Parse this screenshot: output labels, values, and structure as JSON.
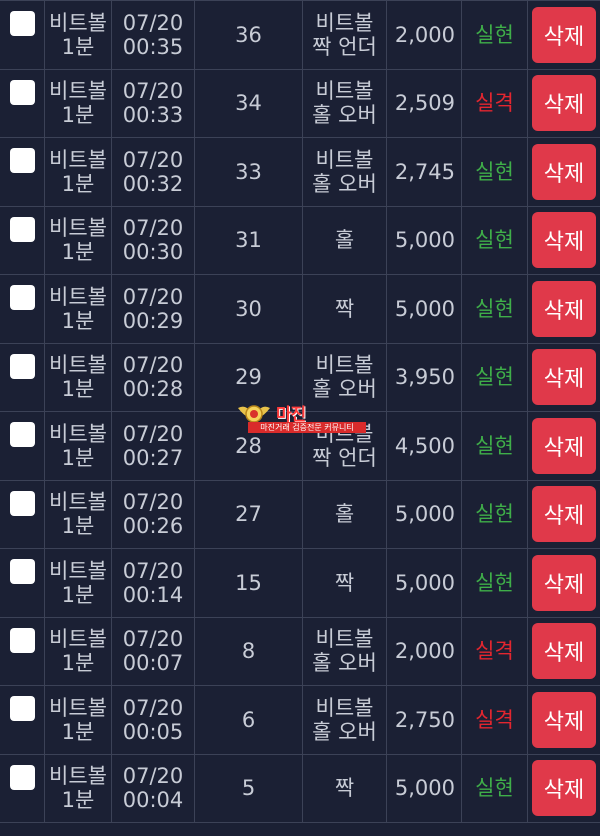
{
  "colors": {
    "background": "#1b2034",
    "win": "#3fae49",
    "lose": "#e3262f",
    "delete_button": "#e0394a"
  },
  "watermark": {
    "title": "마진",
    "subtitle": "마진거래 검증전문 커뮤니티"
  },
  "rows": [
    {
      "game": [
        "비트볼",
        "1분"
      ],
      "date": "07/20",
      "time": "00:35",
      "round": "36",
      "pick": [
        "비트볼",
        "짝 언더"
      ],
      "amount": "2,000",
      "result": "실현",
      "result_type": "win",
      "action": "삭제"
    },
    {
      "game": [
        "비트볼",
        "1분"
      ],
      "date": "07/20",
      "time": "00:33",
      "round": "34",
      "pick": [
        "비트볼",
        "홀 오버"
      ],
      "amount": "2,509",
      "result": "실격",
      "result_type": "lose",
      "action": "삭제"
    },
    {
      "game": [
        "비트볼",
        "1분"
      ],
      "date": "07/20",
      "time": "00:32",
      "round": "33",
      "pick": [
        "비트볼",
        "홀 오버"
      ],
      "amount": "2,745",
      "result": "실현",
      "result_type": "win",
      "action": "삭제"
    },
    {
      "game": [
        "비트볼",
        "1분"
      ],
      "date": "07/20",
      "time": "00:30",
      "round": "31",
      "pick": [
        "홀"
      ],
      "amount": "5,000",
      "result": "실현",
      "result_type": "win",
      "action": "삭제"
    },
    {
      "game": [
        "비트볼",
        "1분"
      ],
      "date": "07/20",
      "time": "00:29",
      "round": "30",
      "pick": [
        "짝"
      ],
      "amount": "5,000",
      "result": "실현",
      "result_type": "win",
      "action": "삭제"
    },
    {
      "game": [
        "비트볼",
        "1분"
      ],
      "date": "07/20",
      "time": "00:28",
      "round": "29",
      "pick": [
        "비트볼",
        "홀 오버"
      ],
      "amount": "3,950",
      "result": "실현",
      "result_type": "win",
      "action": "삭제"
    },
    {
      "game": [
        "비트볼",
        "1분"
      ],
      "date": "07/20",
      "time": "00:27",
      "round": "28",
      "pick": [
        "비트볼",
        "짝 언더"
      ],
      "amount": "4,500",
      "result": "실현",
      "result_type": "win",
      "action": "삭제"
    },
    {
      "game": [
        "비트볼",
        "1분"
      ],
      "date": "07/20",
      "time": "00:26",
      "round": "27",
      "pick": [
        "홀"
      ],
      "amount": "5,000",
      "result": "실현",
      "result_type": "win",
      "action": "삭제"
    },
    {
      "game": [
        "비트볼",
        "1분"
      ],
      "date": "07/20",
      "time": "00:14",
      "round": "15",
      "pick": [
        "짝"
      ],
      "amount": "5,000",
      "result": "실현",
      "result_type": "win",
      "action": "삭제"
    },
    {
      "game": [
        "비트볼",
        "1분"
      ],
      "date": "07/20",
      "time": "00:07",
      "round": "8",
      "pick": [
        "비트볼",
        "홀 오버"
      ],
      "amount": "2,000",
      "result": "실격",
      "result_type": "lose",
      "action": "삭제"
    },
    {
      "game": [
        "비트볼",
        "1분"
      ],
      "date": "07/20",
      "time": "00:05",
      "round": "6",
      "pick": [
        "비트볼",
        "홀 오버"
      ],
      "amount": "2,750",
      "result": "실격",
      "result_type": "lose",
      "action": "삭제"
    },
    {
      "game": [
        "비트볼",
        "1분"
      ],
      "date": "07/20",
      "time": "00:04",
      "round": "5",
      "pick": [
        "짝"
      ],
      "amount": "5,000",
      "result": "실현",
      "result_type": "win",
      "action": "삭제"
    }
  ]
}
